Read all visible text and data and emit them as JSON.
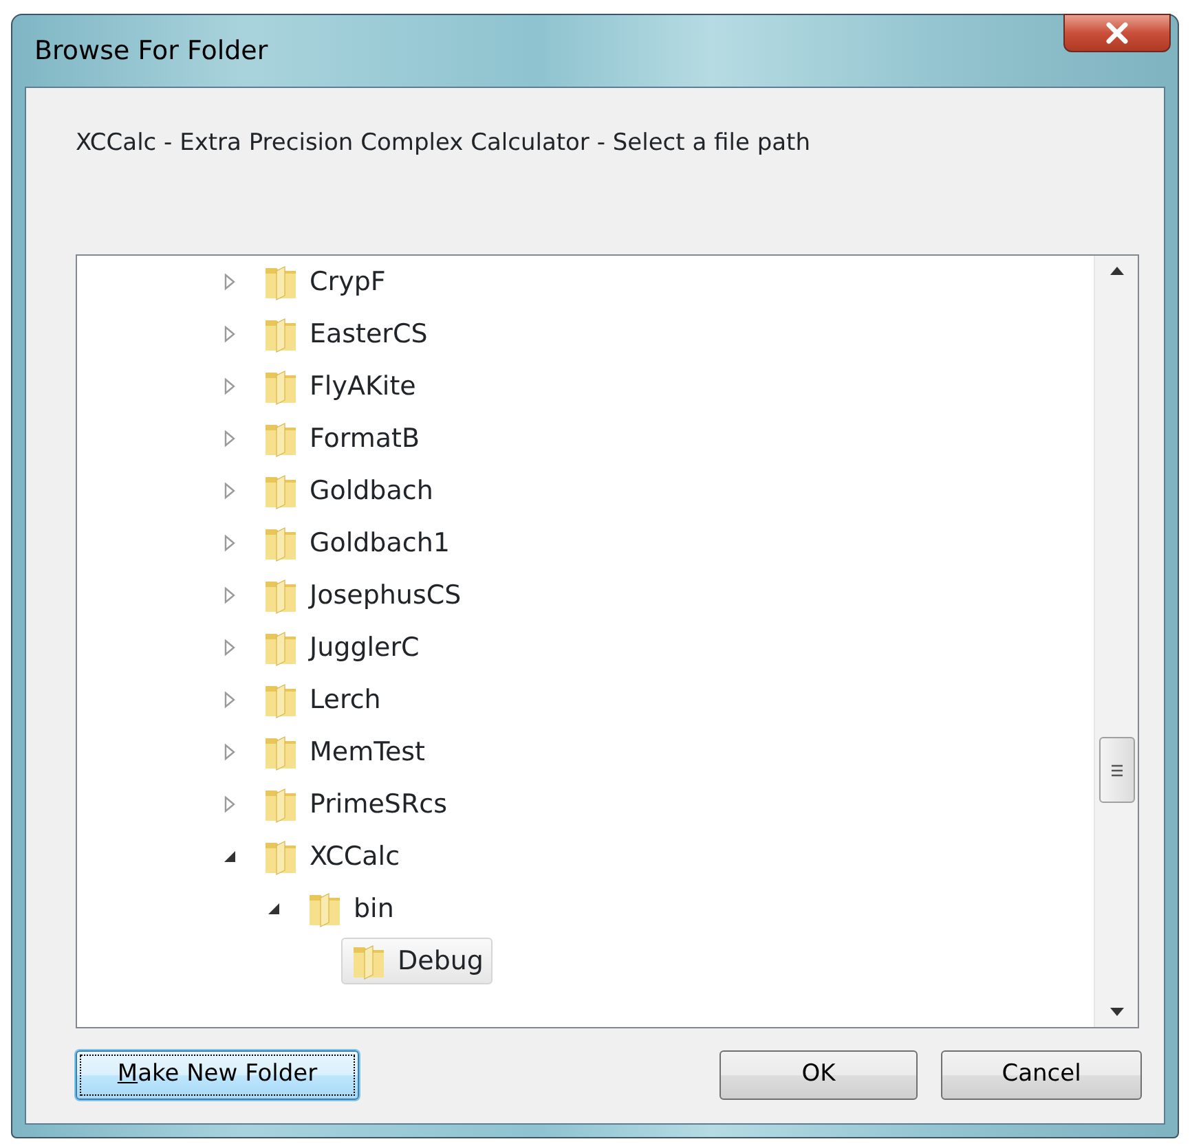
{
  "window": {
    "title": "Browse For Folder"
  },
  "message": "XCCalc - Extra Precision Complex Calculator - Select a file path",
  "tree": [
    {
      "label": "CrypF",
      "kind": "expandable",
      "expanded": false,
      "selected": false
    },
    {
      "label": "EasterCS",
      "kind": "expandable",
      "expanded": false,
      "selected": false
    },
    {
      "label": "FlyAKite",
      "kind": "expandable",
      "expanded": false,
      "selected": false
    },
    {
      "label": "FormatB",
      "kind": "expandable",
      "expanded": false,
      "selected": false
    },
    {
      "label": "Goldbach",
      "kind": "expandable",
      "expanded": false,
      "selected": false
    },
    {
      "label": "Goldbach1",
      "kind": "expandable",
      "expanded": false,
      "selected": false
    },
    {
      "label": "JosephusCS",
      "kind": "expandable",
      "expanded": false,
      "selected": false
    },
    {
      "label": "JugglerC",
      "kind": "expandable",
      "expanded": false,
      "selected": false
    },
    {
      "label": "Lerch",
      "kind": "expandable",
      "expanded": false,
      "selected": false
    },
    {
      "label": "MemTest",
      "kind": "expandable",
      "expanded": false,
      "selected": false
    },
    {
      "label": "PrimeSRcs",
      "kind": "expandable",
      "expanded": false,
      "selected": false
    },
    {
      "label": "XCCalc",
      "kind": "expandable",
      "expanded": true,
      "selected": false,
      "children": [
        {
          "label": "bin",
          "kind": "expandable",
          "expanded": true,
          "selected": false,
          "children": [
            {
              "label": "Debug",
              "kind": "leaf",
              "selected": true
            }
          ]
        }
      ]
    }
  ],
  "buttons": [
    {
      "label_parts": [
        {
          "text": "M",
          "underlined": true
        },
        {
          "text": "ake New Folder",
          "underlined": false
        }
      ],
      "focused": true
    },
    {
      "label": "OK",
      "focused": false
    },
    {
      "label": "Cancel",
      "focused": false
    }
  ]
}
